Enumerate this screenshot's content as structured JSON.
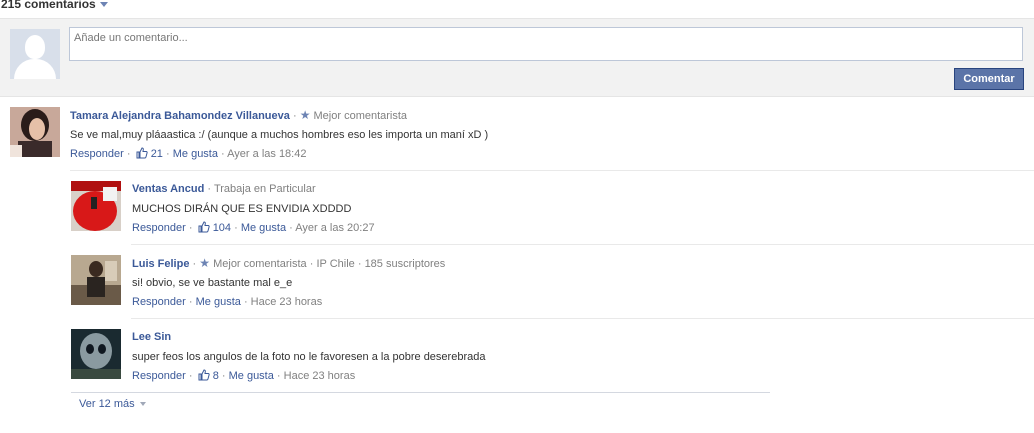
{
  "header": {
    "count_label": "215 comentarios"
  },
  "compose": {
    "placeholder": "Añade un comentario...",
    "submit_label": "Comentar"
  },
  "comments": [
    {
      "name": "Tamara Alejandra Bahamondez Villanueva",
      "badge": "Mejor comentarista",
      "text": "Se ve mal,muy pláaastica :/ (aunque a muchos hombres eso les importa un maní xD )",
      "reply": "Responder",
      "likes": "21",
      "like_label": "Me gusta",
      "time": "Ayer a las 18:42"
    },
    {
      "name": "Ventas Ancud",
      "meta": "Trabaja en Particular",
      "text": "MUCHOS DIRÁN QUE ES ENVIDIA XDDDD",
      "reply": "Responder",
      "likes": "104",
      "like_label": "Me gusta",
      "time": "Ayer a las 20:27"
    },
    {
      "name": "Luis Felipe",
      "badge": "Mejor comentarista",
      "meta1": "IP Chile",
      "meta2": "185 suscriptores",
      "text": "si! obvio, se ve bastante mal e_e",
      "reply": "Responder",
      "like_label": "Me gusta",
      "time": "Hace 23 horas"
    },
    {
      "name": "Lee Sin",
      "text": "super feos los angulos de la foto no le favoresen a la pobre deserebrada",
      "reply": "Responder",
      "likes": "8",
      "like_label": "Me gusta",
      "time": "Hace 23 horas"
    }
  ],
  "footer": {
    "more_label": "Ver 12 más"
  },
  "colors": {
    "link": "#3b5998",
    "button": "#5b74a8",
    "meta": "#808080"
  }
}
